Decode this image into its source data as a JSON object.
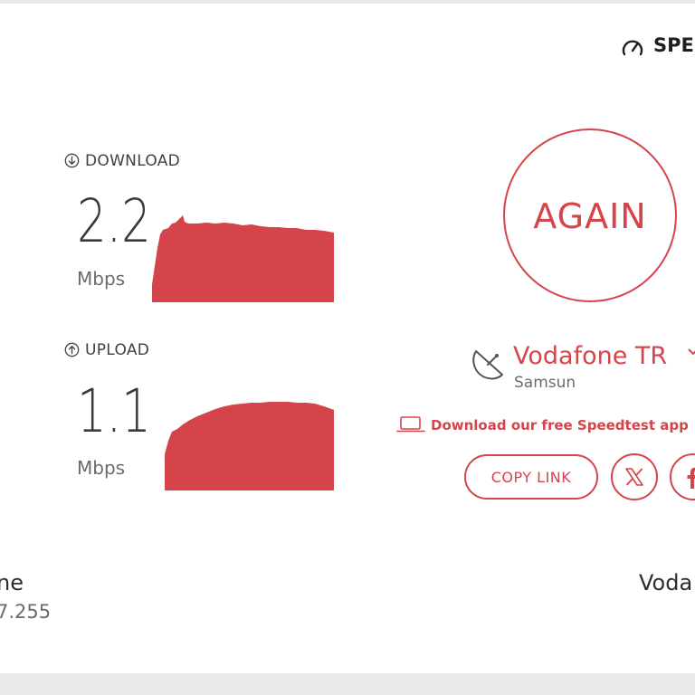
{
  "header": {
    "brand_text": "SPE",
    "brand_icon": "speedometer-icon"
  },
  "download": {
    "label": "DOWNLOAD",
    "icon": "arrow-down-circle-icon",
    "value": "2.2",
    "unit": "Mbps",
    "color": "#d5444b"
  },
  "upload": {
    "label": "UPLOAD",
    "icon": "arrow-up-circle-icon",
    "value": "1.1",
    "unit": "Mbps",
    "color": "#d5444b"
  },
  "actions": {
    "again_label": "AGAIN",
    "copy_link_label": "COPY LINK",
    "share_x_icon": "x-logo-icon",
    "share_facebook_icon": "facebook-icon"
  },
  "provider": {
    "name": "Vodafone TR",
    "location": "Samsun",
    "icon": "satellite-dish-icon",
    "chevron_icon": "chevron-down-icon"
  },
  "promo": {
    "text": "Download our free Speedtest app",
    "icon": "laptop-icon"
  },
  "footer": {
    "left_title": "ne",
    "left_sub": "7.255",
    "right_title": "Voda"
  },
  "colors": {
    "accent": "#d5444b",
    "text": "#3a3a3a",
    "muted": "#6b6b6b",
    "background": "#e9e9e9"
  }
}
